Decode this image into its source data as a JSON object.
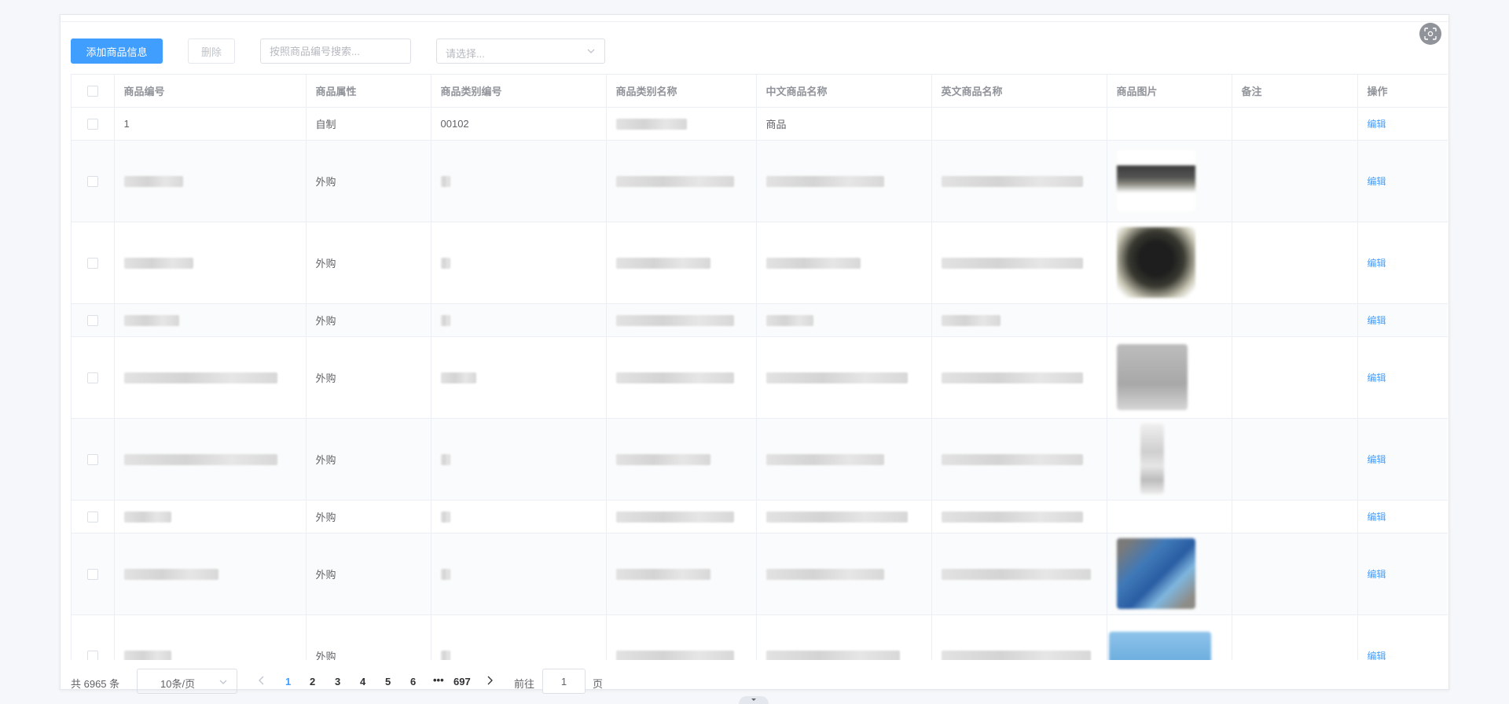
{
  "toolbar": {
    "add_label": "添加商品信息",
    "delete_label": "删除",
    "search_placeholder": "按照商品编号搜索...",
    "select_placeholder": "请选择..."
  },
  "table": {
    "headers": [
      "商品编号",
      "商品属性",
      "商品类别编号",
      "商品类别名称",
      "中文商品名称",
      "英文商品名称",
      "商品图片",
      "备注",
      "操作"
    ],
    "action_label": "编辑",
    "rows": [
      {
        "code": "1",
        "attr": "自制",
        "cat_code": "00102",
        "cat_name": "",
        "cn_name": "商品",
        "en_name": "",
        "remark": ""
      },
      {
        "code": "",
        "attr": "外购",
        "cat_code": "",
        "cat_name": "",
        "cn_name": "",
        "en_name": "",
        "remark": ""
      },
      {
        "code": "",
        "attr": "外购",
        "cat_code": "",
        "cat_name": "",
        "cn_name": "",
        "en_name": "",
        "remark": ""
      },
      {
        "code": "",
        "attr": "外购",
        "cat_code": "",
        "cat_name": "",
        "cn_name": "",
        "en_name": "",
        "remark": ""
      },
      {
        "code": "",
        "attr": "外购",
        "cat_code": "",
        "cat_name": "",
        "cn_name": "",
        "en_name": "",
        "remark": ""
      },
      {
        "code": "",
        "attr": "外购",
        "cat_code": "",
        "cat_name": "",
        "cn_name": "",
        "en_name": "",
        "remark": ""
      },
      {
        "code": "",
        "attr": "外购",
        "cat_code": "",
        "cat_name": "",
        "cn_name": "",
        "en_name": "",
        "remark": ""
      },
      {
        "code": "",
        "attr": "外购",
        "cat_code": "",
        "cat_name": "",
        "cn_name": "",
        "en_name": "",
        "remark": ""
      },
      {
        "code": "",
        "attr": "外购",
        "cat_code": "",
        "cat_name": "",
        "cn_name": "",
        "en_name": "",
        "remark": ""
      }
    ]
  },
  "pagination": {
    "total_text": "共 6965 条",
    "page_size": "10条/页",
    "pages": [
      "1",
      "2",
      "3",
      "4",
      "5",
      "6"
    ],
    "more": "•••",
    "last_page": "697",
    "goto_label": "前往",
    "current": "1",
    "page_unit": "页"
  },
  "icons": [
    "scan-icon",
    "chevron-down-icon",
    "chevron-left-icon",
    "chevron-right-icon",
    "caret-down-icon"
  ],
  "colors": {
    "primary": "#409eff",
    "border": "#ebeef5",
    "header_text": "#909399"
  }
}
